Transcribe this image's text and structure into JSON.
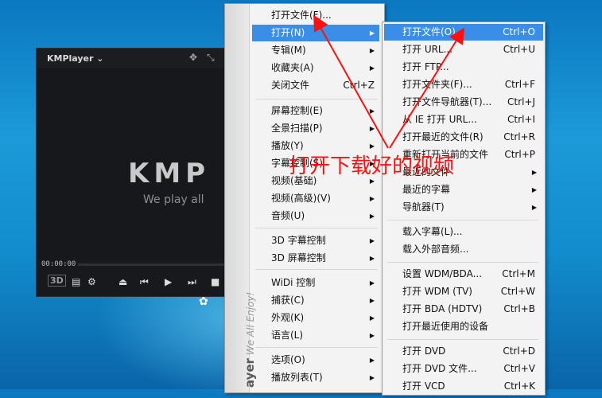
{
  "player": {
    "title": "KMPlayer",
    "logo": "KMP",
    "tagline": "We play all",
    "time": "00:00:00",
    "badge_3d": "3D"
  },
  "menu": {
    "side_brand": "ayer",
    "side_slogan": "We All Enjoy!",
    "items": [
      {
        "label": "打开文件(F)...",
        "shortcut": "",
        "arrow": false
      },
      {
        "label": "打开(N)",
        "shortcut": "",
        "arrow": true,
        "highlight": true
      },
      {
        "label": "专辑(M)",
        "shortcut": "",
        "arrow": true
      },
      {
        "label": "收藏夹(A)",
        "shortcut": "",
        "arrow": true
      },
      {
        "label": "关闭文件",
        "shortcut": "Ctrl+Z",
        "arrow": false
      },
      {
        "label": "屏幕控制(E)",
        "shortcut": "",
        "arrow": true
      },
      {
        "label": "全景扫描(P)",
        "shortcut": "",
        "arrow": true
      },
      {
        "label": "播放(Y)",
        "shortcut": "",
        "arrow": true
      },
      {
        "label": "字幕控制(S)",
        "shortcut": "",
        "arrow": true
      },
      {
        "label": "视频(基础)",
        "shortcut": "",
        "arrow": true
      },
      {
        "label": "视频(高级)(V)",
        "shortcut": "",
        "arrow": true
      },
      {
        "label": "音频(U)",
        "shortcut": "",
        "arrow": true
      },
      {
        "label": "3D 字幕控制",
        "shortcut": "",
        "arrow": true
      },
      {
        "label": "3D 屏幕控制",
        "shortcut": "",
        "arrow": true
      },
      {
        "label": "WiDi 控制",
        "shortcut": "",
        "arrow": true
      },
      {
        "label": "捕获(C)",
        "shortcut": "",
        "arrow": true
      },
      {
        "label": "外观(K)",
        "shortcut": "",
        "arrow": true
      },
      {
        "label": "语言(L)",
        "shortcut": "",
        "arrow": true
      },
      {
        "label": "选项(O)",
        "shortcut": "",
        "arrow": true
      },
      {
        "label": "播放列表(T)",
        "shortcut": "",
        "arrow": true
      }
    ]
  },
  "submenu": {
    "items": [
      {
        "label": "打开文件(O)...",
        "shortcut": "Ctrl+O",
        "arrow": false,
        "highlight": true
      },
      {
        "label": "打开 URL...",
        "shortcut": "Ctrl+U",
        "arrow": false
      },
      {
        "label": "打开 FTP...",
        "shortcut": "",
        "arrow": false
      },
      {
        "label": "打开文件夹(F)...",
        "shortcut": "Ctrl+F",
        "arrow": false
      },
      {
        "label": "打开文件导航器(T)...",
        "shortcut": "Ctrl+J",
        "arrow": false
      },
      {
        "label": "从 IE 打开 URL...",
        "shortcut": "Ctrl+I",
        "arrow": false
      },
      {
        "label": "打开最近的文件(R)",
        "shortcut": "Ctrl+R",
        "arrow": false
      },
      {
        "label": "重新打开当前的文件",
        "shortcut": "Ctrl+P",
        "arrow": false
      },
      {
        "label": "最近的文件",
        "shortcut": "",
        "arrow": true
      },
      {
        "label": "最近的字幕",
        "shortcut": "",
        "arrow": true
      },
      {
        "label": "导航器(T)",
        "shortcut": "",
        "arrow": true
      },
      {
        "label": "载入字幕(L)...",
        "shortcut": "",
        "arrow": false
      },
      {
        "label": "载入外部音频...",
        "shortcut": "",
        "arrow": false
      },
      {
        "label": "设置 WDM/BDA...",
        "shortcut": "Ctrl+M",
        "arrow": false
      },
      {
        "label": "打开 WDM (TV)",
        "shortcut": "Ctrl+W",
        "arrow": false
      },
      {
        "label": "打开 BDA (HDTV)",
        "shortcut": "Ctrl+B",
        "arrow": false
      },
      {
        "label": "打开最近使用的设备",
        "shortcut": "",
        "arrow": false
      },
      {
        "label": "打开 DVD",
        "shortcut": "Ctrl+D",
        "arrow": false
      },
      {
        "label": "打开 DVD 文件...",
        "shortcut": "Ctrl+V",
        "arrow": false
      },
      {
        "label": "打开 VCD",
        "shortcut": "Ctrl+K",
        "arrow": false
      }
    ]
  },
  "annotation": {
    "text": "打开下载好的视频",
    "color": "#ff1010"
  }
}
